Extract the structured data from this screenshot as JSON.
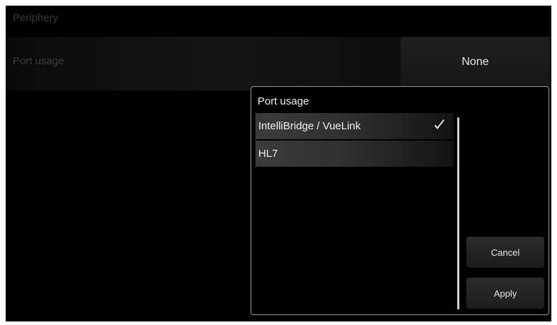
{
  "section": {
    "title": "Periphery"
  },
  "setting": {
    "label": "Port usage",
    "value": "None"
  },
  "dialog": {
    "title": "Port usage",
    "items": [
      {
        "label": "IntelliBridge / VueLink",
        "selected": true,
        "icon": "checkmark-icon"
      },
      {
        "label": "HL7",
        "selected": false
      }
    ],
    "cancel_label": "Cancel",
    "apply_label": "Apply"
  },
  "colors": {
    "background": "#000000",
    "dialog_border": "#9a9a9a",
    "text": "#f2f2f2",
    "muted_text": "#3a3a3a"
  }
}
